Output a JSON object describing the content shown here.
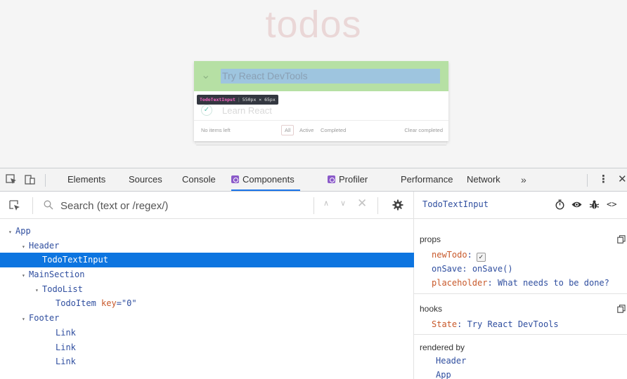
{
  "page": {
    "title": "todos",
    "input_value": "Try React DevTools",
    "tooltip_component": "TodoTextInput",
    "tooltip_size": "550px × 65px",
    "todo_item": "Learn React",
    "footer": {
      "count": "No items left",
      "filters": [
        "All",
        "Active",
        "Completed"
      ],
      "clear": "Clear completed"
    }
  },
  "devtools": {
    "tabs": [
      "Elements",
      "Sources",
      "Console",
      "Components",
      "Profiler",
      "Performance",
      "Network"
    ],
    "active_tab": "Components",
    "overflow_label": "»",
    "accent_color": "#1a73e8",
    "react_badge_color": "#8b5ac9"
  },
  "search": {
    "placeholder": "Search (text or /regex/)"
  },
  "tree": [
    {
      "label": "App",
      "arrow": "▾",
      "indent": 0
    },
    {
      "label": "Header",
      "arrow": "▾",
      "indent": 1
    },
    {
      "label": "TodoTextInput",
      "arrow": "",
      "indent": 2,
      "selected": true
    },
    {
      "label": "MainSection",
      "arrow": "▾",
      "indent": 1
    },
    {
      "label": "TodoList",
      "arrow": "▾",
      "indent": 2
    },
    {
      "label": "TodoItem",
      "arrow": "",
      "indent": 4,
      "key_attr": " key",
      "key_val": "=\"0\""
    },
    {
      "label": "Footer",
      "arrow": "▾",
      "indent": 2
    },
    {
      "label": "Link",
      "arrow": "",
      "indent": 4
    },
    {
      "label": "Link",
      "arrow": "",
      "indent": 4
    },
    {
      "label": "Link",
      "arrow": "",
      "indent": 4
    }
  ],
  "inspector": {
    "component_name": "TodoTextInput",
    "source_label": "<>",
    "props_title": "props",
    "props": [
      {
        "key": "newTodo",
        "sep": ":",
        "value": "",
        "checkbox": true
      },
      {
        "key": "onSave",
        "sep": ": ",
        "value": "onSave()"
      },
      {
        "key": "placeholder",
        "sep": ": ",
        "value": "What needs to be done?"
      }
    ],
    "hooks_title": "hooks",
    "hooks": [
      {
        "key": "State",
        "sep": ": ",
        "value": "Try React DevTools"
      }
    ],
    "rendered_by_title": "rendered by",
    "rendered_by": [
      "Header",
      "App"
    ]
  }
}
